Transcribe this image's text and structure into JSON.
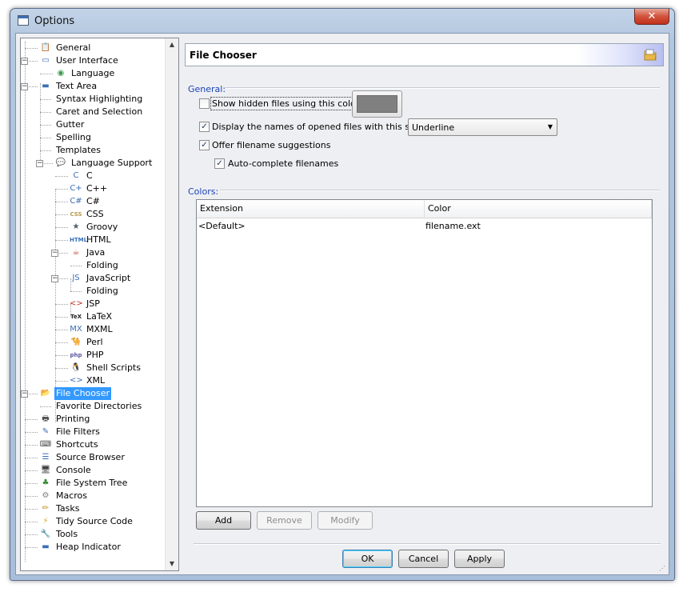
{
  "window": {
    "title": "Options",
    "close_glyph": "✕"
  },
  "tree": {
    "scroll_up": "▲",
    "scroll_down": "▼",
    "items": [
      {
        "label": "General",
        "icon": "general-settings-icon",
        "glyph": "📋",
        "color": "#c89a3a"
      },
      {
        "label": "User Interface",
        "icon": "window-icon",
        "glyph": "▭",
        "color": "#3b6fb4"
      },
      {
        "label": "Language",
        "icon": "globe-icon",
        "glyph": "◉",
        "color": "#3a9a4a"
      },
      {
        "label": "Text Area",
        "icon": "text-area-icon",
        "glyph": "▬",
        "color": "#3b6fb4"
      },
      {
        "label": "Syntax Highlighting"
      },
      {
        "label": "Caret and Selection"
      },
      {
        "label": "Gutter"
      },
      {
        "label": "Spelling"
      },
      {
        "label": "Templates"
      },
      {
        "label": "Language Support",
        "icon": "speech-bubble-icon",
        "glyph": "💬",
        "color": "#4a7abf"
      },
      {
        "label": "C",
        "icon": "c-language-icon",
        "glyph": "C",
        "color": "#3b6fb4"
      },
      {
        "label": "C++",
        "icon": "cpp-language-icon",
        "glyph": "C+",
        "color": "#3b6fb4"
      },
      {
        "label": "C#",
        "icon": "csharp-language-icon",
        "glyph": "C#",
        "color": "#3b6fb4"
      },
      {
        "label": "CSS",
        "icon": "css-icon",
        "glyph": "CSS",
        "color": "#b89a4a"
      },
      {
        "label": "Groovy",
        "icon": "groovy-icon",
        "glyph": "★",
        "color": "#506070"
      },
      {
        "label": "HTML",
        "icon": "html-icon",
        "glyph": "HTML",
        "color": "#3b6fb4"
      },
      {
        "label": "Java",
        "icon": "java-cup-icon",
        "glyph": "☕",
        "color": "#b04a2a"
      },
      {
        "label": "Folding"
      },
      {
        "label": "JavaScript",
        "icon": "javascript-icon",
        "glyph": "JS",
        "color": "#3b6fb4"
      },
      {
        "label": "Folding"
      },
      {
        "label": "JSP",
        "icon": "jsp-icon",
        "glyph": "<>",
        "color": "#c03020"
      },
      {
        "label": "LaTeX",
        "icon": "latex-icon",
        "glyph": "TeX",
        "color": "#222222"
      },
      {
        "label": "MXML",
        "icon": "mxml-icon",
        "glyph": "MX",
        "color": "#3b6fb4"
      },
      {
        "label": "Perl",
        "icon": "camel-icon",
        "glyph": "🐪",
        "color": "#2a7a9a"
      },
      {
        "label": "PHP",
        "icon": "php-icon",
        "glyph": "php",
        "color": "#5a5aa0"
      },
      {
        "label": "Shell Scripts",
        "icon": "penguin-icon",
        "glyph": "🐧",
        "color": "#222222"
      },
      {
        "label": "XML",
        "icon": "xml-icon",
        "glyph": "<>",
        "color": "#3b6fb4"
      },
      {
        "label": "File Chooser",
        "icon": "folder-icon",
        "glyph": "📂",
        "color": "#d8a830"
      },
      {
        "label": "Favorite Directories"
      },
      {
        "label": "Printing",
        "icon": "printer-icon",
        "glyph": "🖶",
        "color": "#505050"
      },
      {
        "label": "File Filters",
        "icon": "filter-icon",
        "glyph": "✎",
        "color": "#3b6fb4"
      },
      {
        "label": "Shortcuts",
        "icon": "keyboard-icon",
        "glyph": "⌨",
        "color": "#505050"
      },
      {
        "label": "Source Browser",
        "icon": "source-browser-icon",
        "glyph": "☰",
        "color": "#3b6fb4"
      },
      {
        "label": "Console",
        "icon": "monitor-icon",
        "glyph": "🖥",
        "color": "#404040"
      },
      {
        "label": "File System Tree",
        "icon": "tree-icon",
        "glyph": "♣",
        "color": "#3a8a3a"
      },
      {
        "label": "Macros",
        "icon": "macros-gear-icon",
        "glyph": "⚙",
        "color": "#808080"
      },
      {
        "label": "Tasks",
        "icon": "pencil-icon",
        "glyph": "✏",
        "color": "#c8902a"
      },
      {
        "label": "Tidy Source Code",
        "icon": "lightning-icon",
        "glyph": "⚡",
        "color": "#d8a830"
      },
      {
        "label": "Tools",
        "icon": "wrench-icon",
        "glyph": "🔧",
        "color": "#808080"
      },
      {
        "label": "Heap Indicator",
        "icon": "heap-indicator-icon",
        "glyph": "▬",
        "color": "#3b6fb4"
      }
    ]
  },
  "panel": {
    "title": "File Chooser",
    "header_icon": "folder-icon",
    "general_label": "General:",
    "options": {
      "show_hidden": {
        "label": "Show hidden files using this color:",
        "checked": false,
        "color": "#808080"
      },
      "display_names": {
        "label": "Display the names of opened files with this style:",
        "checked": true
      },
      "style_value": "Underline",
      "suggestions": {
        "label": "Offer filename suggestions",
        "checked": true
      },
      "autocomplete": {
        "label": "Auto-complete filenames",
        "checked": true
      }
    },
    "colors_label": "Colors:",
    "table": {
      "columns": [
        "Extension",
        "Color"
      ],
      "rows": [
        {
          "extension": "<Default>",
          "color": "filename.ext"
        }
      ]
    },
    "buttons": {
      "add": "Add",
      "remove": "Remove",
      "modify": "Modify"
    }
  },
  "footer": {
    "ok": "OK",
    "cancel": "Cancel",
    "apply": "Apply"
  },
  "check_glyph": "✓"
}
